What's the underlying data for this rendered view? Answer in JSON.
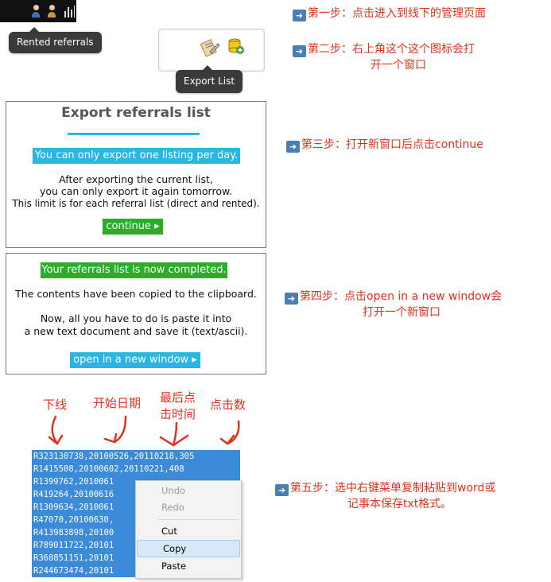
{
  "topbar": {
    "icons": [
      "user-icon",
      "user-icon",
      "stats-icon"
    ]
  },
  "tooltip_rented": "Rented referrals",
  "tooltip_export": "Export List",
  "steps": {
    "s1": "第一步：点击进入到线下的管理页面",
    "s2_line1": "第二步：右上角这个这个图标会打",
    "s2_line2": "开一个窗口",
    "s3": "第三步：打开新窗口后点击continue",
    "s4_line1": "第四步：点击open in a new window会",
    "s4_line2": "打开一个新窗口",
    "s5_line1": "第五步：选中右键菜单复制粘贴到word或",
    "s5_line2": "记事本保存txt格式。"
  },
  "panel1": {
    "title": "Export referrals list",
    "notice": "You can only export one listing per day.",
    "line1": "After exporting the current list,",
    "line2": "you can only export it again tomorrow.",
    "line3": "This limit is for each referral list (direct and rented).",
    "button": "continue ▸"
  },
  "panel2": {
    "notice": "Your referrals list is now completed.",
    "line1": "The contents have been copied to the clipboard.",
    "line2": "Now, all you have to do is paste it into",
    "line3": "a new text document and save it (text/ascii).",
    "button": "open in a new window ▸"
  },
  "columns": {
    "c1": "下线",
    "c2": "开始日期",
    "c3_line1": "最后点",
    "c3_line2": "击时间",
    "c4": "点击数"
  },
  "data_rows": [
    "R323130738,20100526,20110218,305",
    "R1415508,20100602,20110221,408",
    "R1399762,2010061",
    "R419264,20100616",
    "R1309634,2010061",
    "R47070,20100630,",
    "R413983898,20100",
    "R789011722,20101",
    "R368851151,20101",
    "R244673474,20101"
  ],
  "context_menu": {
    "undo": "Undo",
    "redo": "Redo",
    "cut": "Cut",
    "copy": "Copy",
    "paste": "Paste"
  },
  "colors": {
    "step_red": "#e0321c",
    "cyan": "#28b6e4",
    "green": "#2aae2a",
    "selection": "#3b8bd8"
  }
}
